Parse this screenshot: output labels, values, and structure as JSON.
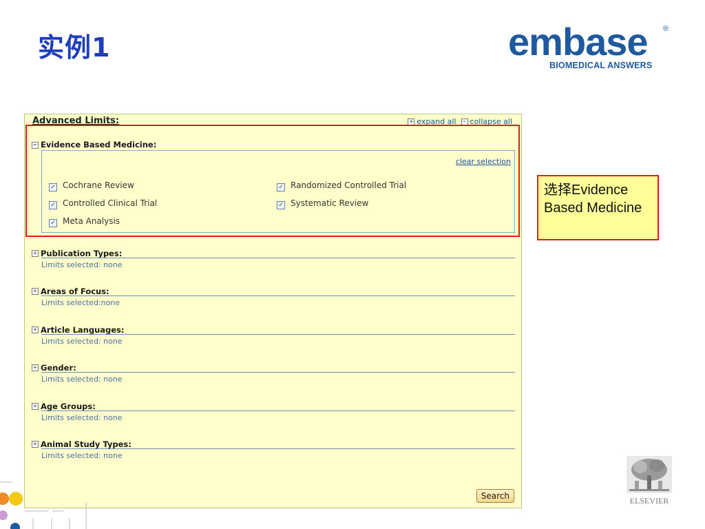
{
  "slide_title": "实例1",
  "logo": {
    "word": "embase",
    "tagline": "BIOMEDICAL ANSWERS",
    "reg": "®"
  },
  "panel": {
    "header": "Advanced Limits:",
    "expand_all": "expand all",
    "collapse_all": "collapse all",
    "ebm": {
      "title": "Evidence Based Medicine:",
      "clear_selection": "clear selection",
      "options": [
        {
          "label": "Cochrane Review",
          "checked": true
        },
        {
          "label": "Randomized Controlled Trial",
          "checked": true
        },
        {
          "label": "Controlled Clinical Trial",
          "checked": true
        },
        {
          "label": "Systematic Review",
          "checked": true
        },
        {
          "label": "Meta Analysis",
          "checked": true
        }
      ]
    },
    "sections": [
      {
        "title": "Publication Types:",
        "status": "Limits selected: none"
      },
      {
        "title": "Areas of Focus:",
        "status": "Limits selected:none"
      },
      {
        "title": "Article Languages:",
        "status": "Limits selected: none"
      },
      {
        "title": "Gender:",
        "status": "Limits selected: none"
      },
      {
        "title": "Age Groups:",
        "status": "Limits selected: none"
      },
      {
        "title": "Animal Study Types:",
        "status": "Limits selected: none"
      }
    ],
    "search_label": "Search"
  },
  "callout": {
    "text": "选择Evidence Based Medicine"
  },
  "elsevier": {
    "name": "ELSEVIER"
  }
}
